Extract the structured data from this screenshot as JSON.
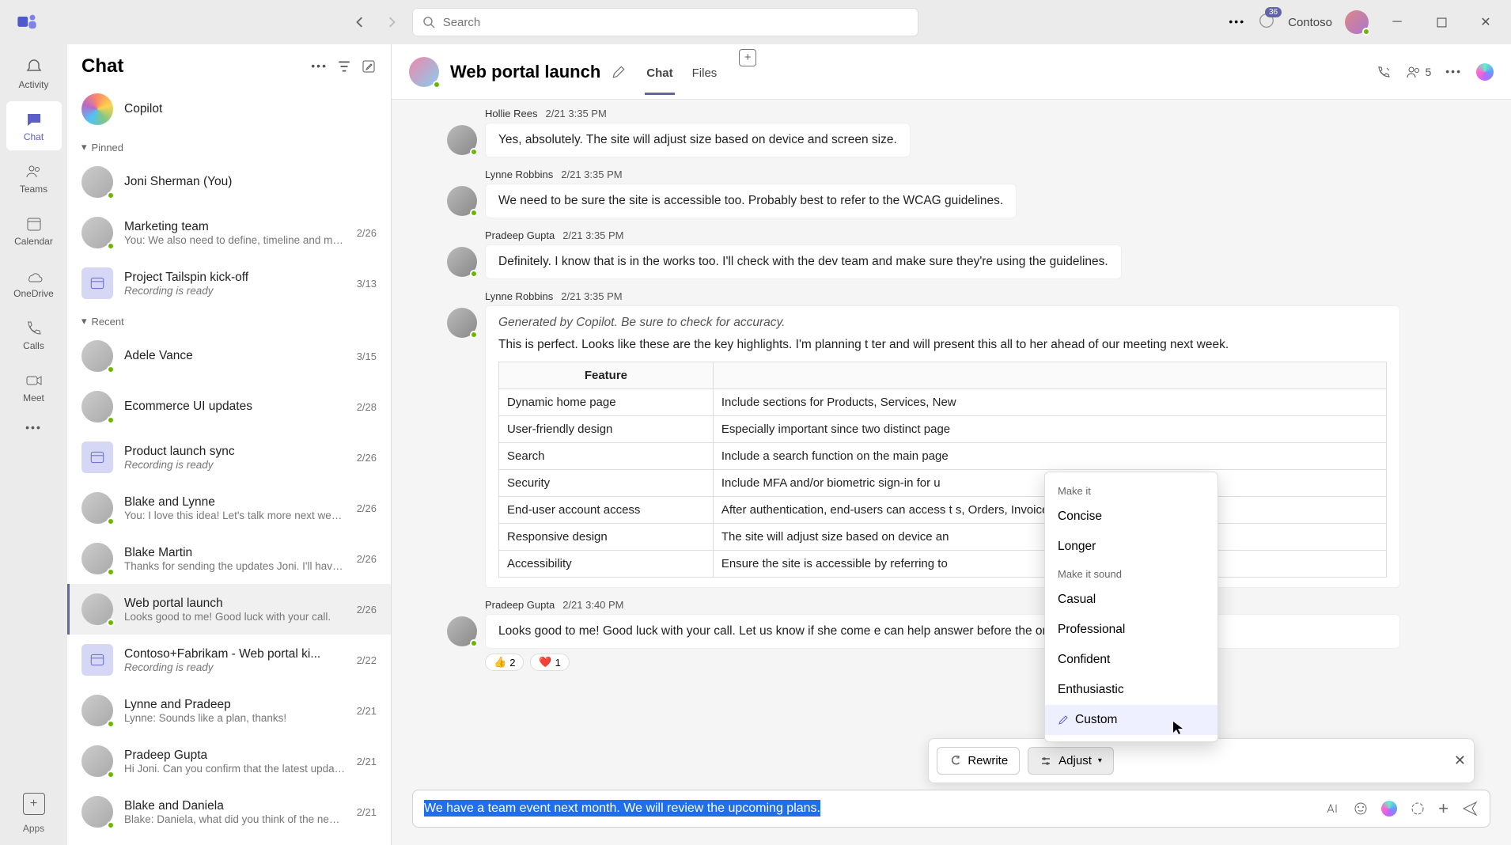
{
  "titlebar": {
    "search_placeholder": "Search",
    "notif_count": "36",
    "org": "Contoso"
  },
  "rail": {
    "items": [
      {
        "key": "activity",
        "label": "Activity"
      },
      {
        "key": "chat",
        "label": "Chat"
      },
      {
        "key": "teams",
        "label": "Teams"
      },
      {
        "key": "calendar",
        "label": "Calendar"
      },
      {
        "key": "onedrive",
        "label": "OneDrive"
      },
      {
        "key": "calls",
        "label": "Calls"
      },
      {
        "key": "meet",
        "label": "Meet"
      }
    ],
    "apps_label": "Apps"
  },
  "sidebar": {
    "title": "Chat",
    "copilot": "Copilot",
    "section_pinned": "Pinned",
    "section_recent": "Recent",
    "pinned": [
      {
        "name": "Joni Sherman (You)",
        "sub": "",
        "date": ""
      },
      {
        "name": "Marketing team",
        "sub": "You: We also need to define, timeline and miles...",
        "date": "2/26"
      },
      {
        "name": "Project Tailspin kick-off",
        "sub": "Recording is ready",
        "date": "3/13",
        "italic": true,
        "team": true
      }
    ],
    "recent": [
      {
        "name": "Adele Vance",
        "sub": "",
        "date": "3/15"
      },
      {
        "name": "Ecommerce UI updates",
        "sub": "",
        "date": "2/28"
      },
      {
        "name": "Product launch sync",
        "sub": "Recording is ready",
        "date": "2/26",
        "italic": true,
        "team": true
      },
      {
        "name": "Blake and Lynne",
        "sub": "You: I love this idea! Let's talk more next week.",
        "date": "2/26"
      },
      {
        "name": "Blake Martin",
        "sub": "Thanks for sending the updates Joni. I'll have s...",
        "date": "2/26"
      },
      {
        "name": "Web portal launch",
        "sub": "Looks good to me! Good luck with your call.",
        "date": "2/26",
        "selected": true
      },
      {
        "name": "Contoso+Fabrikam - Web portal ki...",
        "sub": "Recording is ready",
        "date": "2/22",
        "italic": true,
        "team": true
      },
      {
        "name": "Lynne and Pradeep",
        "sub": "Lynne: Sounds like a plan, thanks!",
        "date": "2/21"
      },
      {
        "name": "Pradeep Gupta",
        "sub": "Hi Joni. Can you confirm that the latest updates...",
        "date": "2/21"
      },
      {
        "name": "Blake and Daniela",
        "sub": "Blake: Daniela, what did you think of the new d...",
        "date": "2/21"
      }
    ]
  },
  "chat_header": {
    "title": "Web portal launch",
    "tabs": [
      "Chat",
      "Files"
    ],
    "people_count": "5"
  },
  "messages": [
    {
      "author": "Hollie Rees",
      "time": "2/21 3:35 PM",
      "text": "Yes, absolutely. The site will adjust size based on device and screen size."
    },
    {
      "author": "Lynne Robbins",
      "time": "2/21 3:35 PM",
      "text": "We need to be sure the site is accessible too. Probably best to refer to the WCAG guidelines."
    },
    {
      "author": "Pradeep Gupta",
      "time": "2/21 3:35 PM",
      "text": "Definitely. I know that is in the works too. I'll check with the dev team and make sure they're using the guidelines."
    }
  ],
  "copilot_message": {
    "author": "Lynne Robbins",
    "time": "2/21 3:35 PM",
    "generated_note": "Generated by Copilot. Be sure to check for accuracy.",
    "intro": "This is perfect. Looks like these are the key highlights. I'm planning t                                                      ter and will present this all to her ahead of our meeting next week.",
    "table_header": "Feature",
    "rows": [
      {
        "f": "Dynamic home page",
        "d": "Include sections for Products, Services, New"
      },
      {
        "f": "User-friendly design",
        "d": "Especially important since two distinct page"
      },
      {
        "f": "Search",
        "d": "Include a search function on the main page"
      },
      {
        "f": "Security",
        "d": "Include MFA and/or biometric sign-in for u"
      },
      {
        "f": "End-user account access",
        "d": "After authentication, end-users can access t                                        s, Orders, Invoices, and Support tickets. 5"
      },
      {
        "f": "Responsive design",
        "d": "The site will adjust size based on device an"
      },
      {
        "f": "Accessibility",
        "d": "Ensure the site is accessible by referring to"
      }
    ]
  },
  "reply_message": {
    "author": "Pradeep Gupta",
    "time": "2/21 3:40 PM",
    "text": "Looks good to me! Good luck with your call. Let us know if she come                                                e can help answer before the on-site meeting.",
    "reactions": [
      {
        "emoji": "👍",
        "count": "2"
      },
      {
        "emoji": "❤️",
        "count": "1"
      }
    ]
  },
  "compose": {
    "text": "We have a team event next month. We will review the upcoming plans."
  },
  "copilot_bar": {
    "rewrite": "Rewrite",
    "adjust": "Adjust"
  },
  "adjust_menu": {
    "make_it": "Make it",
    "opts1": [
      "Concise",
      "Longer"
    ],
    "make_sound": "Make it sound",
    "opts2": [
      "Casual",
      "Professional",
      "Confident",
      "Enthusiastic"
    ],
    "custom": "Custom"
  }
}
